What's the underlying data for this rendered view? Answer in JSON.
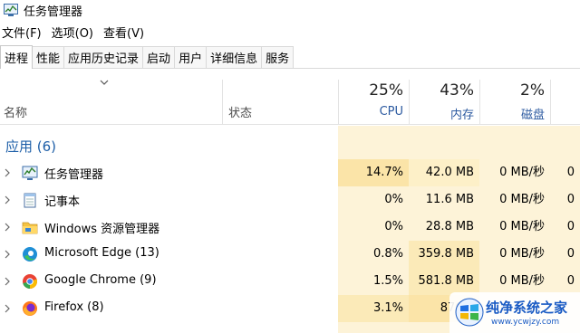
{
  "window": {
    "title": "任务管理器"
  },
  "menu": [
    "文件(F)",
    "选项(O)",
    "查看(V)"
  ],
  "tabs": [
    {
      "label": "进程",
      "active": true
    },
    {
      "label": "性能",
      "active": false
    },
    {
      "label": "应用历史记录",
      "active": false
    },
    {
      "label": "启动",
      "active": false
    },
    {
      "label": "用户",
      "active": false
    },
    {
      "label": "详细信息",
      "active": false
    },
    {
      "label": "服务",
      "active": false
    }
  ],
  "columns": {
    "name": "名称",
    "status": "状态",
    "cpu": {
      "percent": "25%",
      "label": "CPU"
    },
    "memory": {
      "percent": "43%",
      "label": "内存"
    },
    "disk": {
      "percent": "2%",
      "label": "磁盘"
    }
  },
  "group": {
    "label": "应用 (6)"
  },
  "processes": [
    {
      "name": "任务管理器",
      "icon": "task-manager-icon",
      "cpu": "14.7%",
      "memory": "42.0 MB",
      "disk": "0 MB/秒",
      "network": "0"
    },
    {
      "name": "记事本",
      "icon": "notepad-icon",
      "cpu": "0%",
      "memory": "11.6 MB",
      "disk": "0 MB/秒",
      "network": "0"
    },
    {
      "name": "Windows 资源管理器",
      "icon": "folder-icon",
      "cpu": "0%",
      "memory": "28.8 MB",
      "disk": "0 MB/秒",
      "network": "0"
    },
    {
      "name": "Microsoft Edge (13)",
      "icon": "edge-icon",
      "cpu": "0.8%",
      "memory": "359.8 MB",
      "disk": "0 MB/秒",
      "network": "0"
    },
    {
      "name": "Google Chrome (9)",
      "icon": "chrome-icon",
      "cpu": "1.5%",
      "memory": "581.8 MB",
      "disk": "0 MB/秒",
      "network": "0"
    },
    {
      "name": "Firefox (8)",
      "icon": "firefox-icon",
      "cpu": "3.1%",
      "memory": "870.7",
      "disk": "",
      "network": ""
    }
  ],
  "watermark": {
    "title": "纯净系统之家",
    "url": "www.ycwjzy.com"
  },
  "colors": {
    "cpu_high": "#fbe4a8",
    "cpu_low": "#fdf3d8",
    "mem_high": "#fbeab8",
    "mem_low": "#fdf3d8",
    "header_blue": "#2c5aa0",
    "group_blue": "#1e5fa8"
  }
}
